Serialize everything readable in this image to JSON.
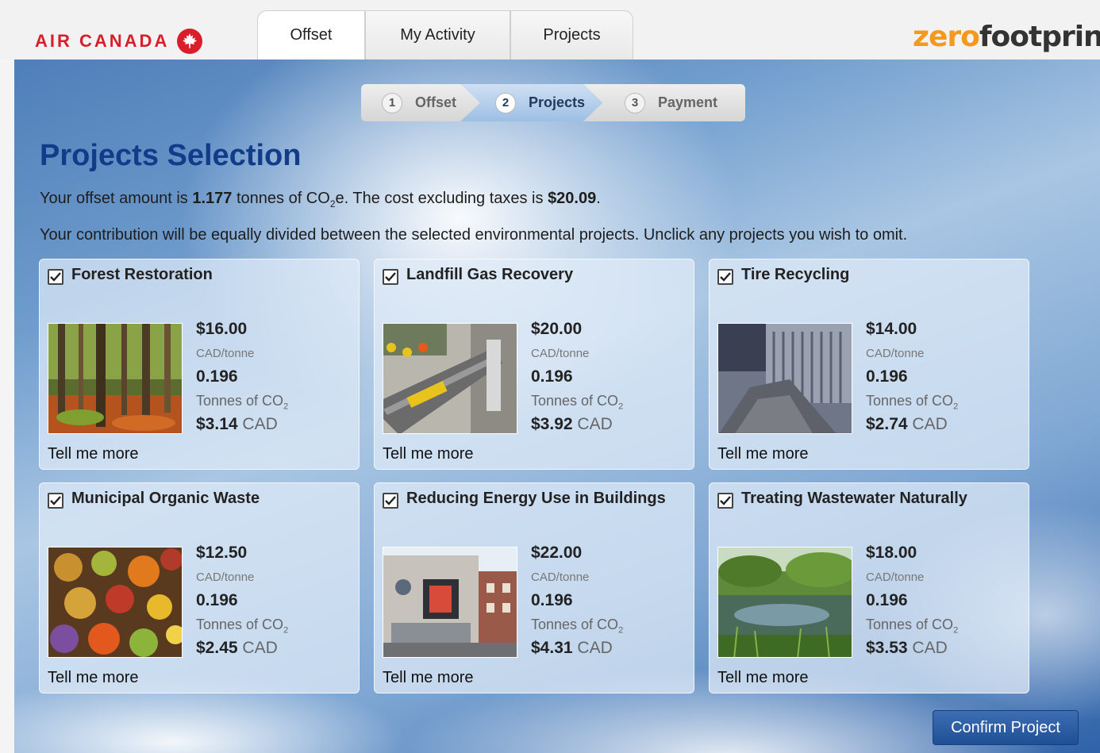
{
  "brand": {
    "name": "AIR CANADA",
    "partner_prefix": "zero",
    "partner_suffix": "footprint",
    "trademark": "™"
  },
  "nav_tabs": [
    {
      "label": "Offset",
      "active": true
    },
    {
      "label": "My Activity",
      "active": false
    },
    {
      "label": "Projects",
      "active": false
    }
  ],
  "stepper": [
    {
      "num": "1",
      "label": "Offset",
      "active": false
    },
    {
      "num": "2",
      "label": "Projects",
      "active": true
    },
    {
      "num": "3",
      "label": "Payment",
      "active": false
    }
  ],
  "page": {
    "title": "Projects Selection",
    "offset_pre": "Your offset amount is ",
    "offset_amount": "1.177",
    "offset_mid": " tonnes of CO",
    "offset_sub": "2",
    "offset_post": "e. The cost excluding taxes is ",
    "cost": "$20.09",
    "cost_end": ".",
    "instruction": "Your contribution will be equally divided between the selected environmental projects. Unclick any projects you wish to omit."
  },
  "projects": [
    {
      "name": "Forest Restoration",
      "checked": true,
      "price": "$16.00",
      "unit": "CAD/tonne",
      "tonnes": "0.196",
      "tonnes_label": "Tonnes of CO",
      "tonnes_sub": "2",
      "amount": "$3.14",
      "currency": "CAD",
      "more": "Tell me more",
      "image": "forest"
    },
    {
      "name": "Landfill Gas Recovery",
      "checked": true,
      "price": "$20.00",
      "unit": "CAD/tonne",
      "tonnes": "0.196",
      "tonnes_label": "Tonnes of CO",
      "tonnes_sub": "2",
      "amount": "$3.92",
      "currency": "CAD",
      "more": "Tell me more",
      "image": "pipe"
    },
    {
      "name": "Tire Recycling",
      "checked": true,
      "price": "$14.00",
      "unit": "CAD/tonne",
      "tonnes": "0.196",
      "tonnes_label": "Tonnes of CO",
      "tonnes_sub": "2",
      "amount": "$2.74",
      "currency": "CAD",
      "more": "Tell me more",
      "image": "tire"
    },
    {
      "name": "Municipal Organic Waste",
      "checked": true,
      "price": "$12.50",
      "unit": "CAD/tonne",
      "tonnes": "0.196",
      "tonnes_label": "Tonnes of CO",
      "tonnes_sub": "2",
      "amount": "$2.45",
      "currency": "CAD",
      "more": "Tell me more",
      "image": "veg"
    },
    {
      "name": "Reducing Energy Use in Buildings",
      "checked": true,
      "price": "$22.00",
      "unit": "CAD/tonne",
      "tonnes": "0.196",
      "tonnes_label": "Tonnes of CO",
      "tonnes_sub": "2",
      "amount": "$4.31",
      "currency": "CAD",
      "more": "Tell me more",
      "image": "building"
    },
    {
      "name": "Treating Wastewater Naturally",
      "checked": true,
      "price": "$18.00",
      "unit": "CAD/tonne",
      "tonnes": "0.196",
      "tonnes_label": "Tonnes of CO",
      "tonnes_sub": "2",
      "amount": "$3.53",
      "currency": "CAD",
      "more": "Tell me more",
      "image": "wetland"
    }
  ],
  "confirm_label": "Confirm Project",
  "colors": {
    "brand_red": "#d81e2a",
    "title_blue": "#123c8a",
    "button_blue": "#2a5ba3",
    "partner_orange": "#f39a1e"
  }
}
